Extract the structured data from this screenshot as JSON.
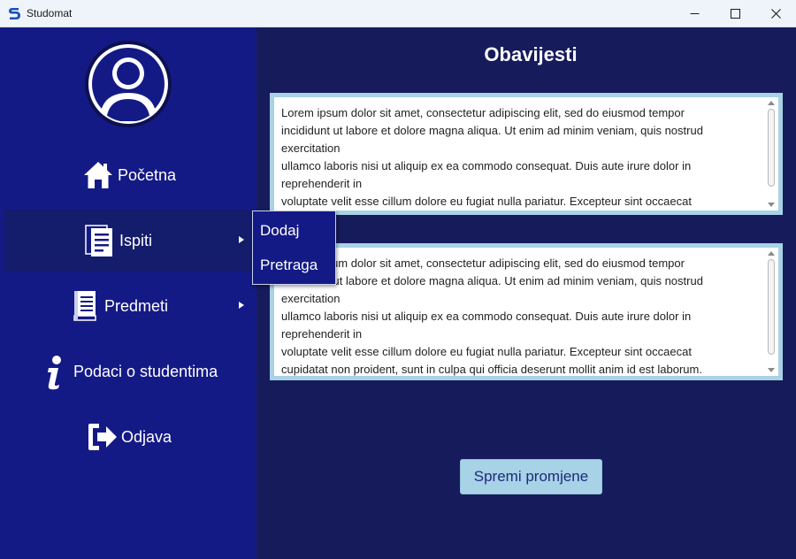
{
  "window": {
    "title": "Studomat"
  },
  "sidebar": {
    "items": [
      {
        "label": "Početna",
        "icon": "home-icon"
      },
      {
        "label": "Ispiti",
        "icon": "document-icon"
      },
      {
        "label": "Predmeti",
        "icon": "book-icon"
      },
      {
        "label": "Podaci o studentima",
        "icon": "info-icon"
      },
      {
        "label": "Odjava",
        "icon": "logout-icon"
      }
    ]
  },
  "submenu": {
    "items": [
      {
        "label": "Dodaj"
      },
      {
        "label": "Pretraga"
      }
    ]
  },
  "main": {
    "title": "Obavijesti",
    "notices": [
      {
        "text": "Lorem ipsum dolor sit amet, consectetur adipiscing elit, sed do eiusmod tempor\nincididunt ut labore et dolore magna aliqua. Ut enim ad minim veniam, quis nostrud\nexercitation\nullamco laboris nisi ut aliquip ex ea commodo consequat. Duis aute irure dolor in\nreprehenderit in\nvoluptate velit esse cillum dolore eu fugiat nulla pariatur. Excepteur sint occaecat"
      },
      {
        "text": "Lorem ipsum dolor sit amet, consectetur adipiscing elit, sed do eiusmod tempor\nincididunt ut labore et dolore magna aliqua. Ut enim ad minim veniam, quis nostrud\nexercitation\nullamco laboris nisi ut aliquip ex ea commodo consequat. Duis aute irure dolor in\nreprehenderit in\nvoluptate velit esse cillum dolore eu fugiat nulla pariatur. Excepteur sint occaecat\ncupidatat non proident, sunt in culpa qui officia deserunt mollit anim id est laborum."
      }
    ],
    "save_label": "Spremi promjene"
  },
  "colors": {
    "sidebar_bg": "#141a85",
    "main_bg": "#161b5c",
    "accent": "#a8d2e6"
  }
}
